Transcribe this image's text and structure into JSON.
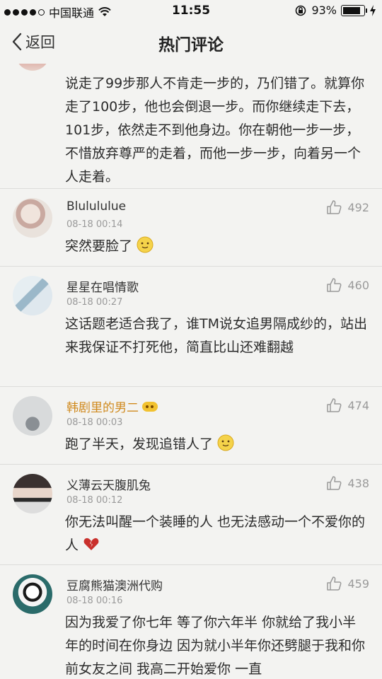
{
  "status": {
    "carrier": "中国联通",
    "time": "11:55",
    "battery": "93%",
    "battery_level": 0.93
  },
  "nav": {
    "back_label": "返回",
    "title": "热门评论"
  },
  "top_comment": {
    "text": "说走了99步那人不肯走一步的，乃们错了。就算你走了100步，他也会倒退一步。而你继续走下去，101步，依然走不到他身边。你在朝他一步一步，不惜放弃尊严的走着，而他一步一步，向着另一个人走着。"
  },
  "comments": [
    {
      "name": "Blulululue",
      "date": "08-18 00:14",
      "likes": "492",
      "text": "突然要脸了",
      "emoji": "cute-face-emoji"
    },
    {
      "name": "星星在唱情歌",
      "date": "08-18 00:27",
      "likes": "460",
      "text": "这话题老适合我了，谁TM说女追男隔成纱的，站出来我保证不打死他，简直比山还难翻越"
    },
    {
      "name": "韩剧里的男二",
      "date": "08-18 00:03",
      "likes": "474",
      "text": "跑了半天，发现追错人了",
      "emoji": "cute-face-emoji",
      "vip": true
    },
    {
      "name": "义薄云天腹肌兔",
      "date": "08-18 00:12",
      "likes": "438",
      "text": "你无法叫醒一个装睡的人  也无法感动一个不爱你的人",
      "emoji": "broken-heart-emoji"
    },
    {
      "name": "豆腐熊猫澳洲代购",
      "date": "08-18 00:16",
      "likes": "459",
      "text": "因为我爱了你七年 等了你六年半 你就给了我小半年的时间在你身边 因为就小半年你还劈腿于我和你前女友之间 我高二开始爱你 一直"
    }
  ]
}
